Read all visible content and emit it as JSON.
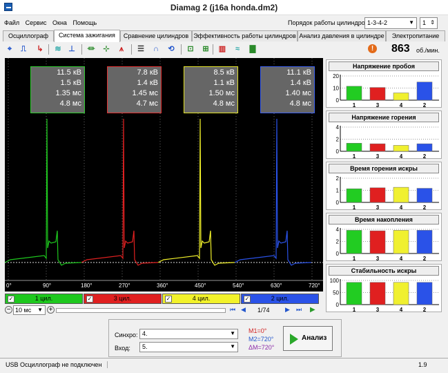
{
  "window": {
    "title": "Diamag 2 (j16a honda.dm2)"
  },
  "menu": [
    "Файл",
    "Сервис",
    "Окна",
    "Помощь"
  ],
  "cylinder_order": {
    "label": "Порядок работы цилиндров",
    "value": "1-3-4-2",
    "count": "1"
  },
  "tabs": [
    "Осциллограф",
    "Система зажигания",
    "Сравнение цилиндров",
    "Эффективность работы цилиндров",
    "Анализ давления в цилиндре",
    "Электропитание"
  ],
  "rpm": {
    "value": "863",
    "unit": "об./мин."
  },
  "readouts": [
    {
      "kv": "11.5 кВ",
      "kv2": "1.5 кВ",
      "ms": "1.35 мс",
      "ms2": "4.8 мс",
      "color": "#2ecc2e"
    },
    {
      "kv": "7.8 кВ",
      "kv2": "1.4 кВ",
      "ms": "1.45 мс",
      "ms2": "4.7 мс",
      "color": "#e23030"
    },
    {
      "kv": "8.5 кВ",
      "kv2": "1.1 кВ",
      "ms": "1.50 мс",
      "ms2": "4.8 мс",
      "color": "#e6e62a"
    },
    {
      "kv": "11.1 кВ",
      "kv2": "1.4 кВ",
      "ms": "1.40 мс",
      "ms2": "4.8 мс",
      "color": "#3a5ef0"
    }
  ],
  "degrees": [
    "0°",
    "90°",
    "180°",
    "270°",
    "360°",
    "450°",
    "540°",
    "630°",
    "720°"
  ],
  "cylinders": [
    {
      "label": "1 цил.",
      "color": "#1ec81e"
    },
    {
      "label": "3 цил.",
      "color": "#e02020"
    },
    {
      "label": "4 цил.",
      "color": "#f2f22a"
    },
    {
      "label": "2 цил.",
      "color": "#2a52e8"
    }
  ],
  "controls": {
    "timebase": "10 мс",
    "page": "1/74"
  },
  "panels": [
    {
      "title": "Напряжение пробоя",
      "yticks": [
        "20",
        "10",
        "0"
      ],
      "ymax": 20,
      "values": [
        11.5,
        10.5,
        6,
        15
      ]
    },
    {
      "title": "Напряжение горения",
      "yticks": [
        "4",
        "2",
        "0"
      ],
      "ymax": 4.5,
      "values": [
        1.5,
        1.4,
        1.1,
        1.4
      ]
    },
    {
      "title": "Время горения искры",
      "yticks": [
        "2",
        "1",
        "0"
      ],
      "ymax": 2.4,
      "values": [
        1.35,
        1.45,
        1.5,
        1.4
      ]
    },
    {
      "title": "Время накопления",
      "yticks": [
        "4",
        "2",
        "0"
      ],
      "ymax": 5,
      "values": [
        4.8,
        4.7,
        4.8,
        4.8
      ]
    },
    {
      "title": "Стабильность искры",
      "yticks": [
        "100",
        "50",
        "0"
      ],
      "ymax": 100,
      "values": [
        92,
        92,
        92,
        92
      ]
    }
  ],
  "panel_xlabels": [
    "1",
    "3",
    "4",
    "2"
  ],
  "bar_colors": [
    "#22cc22",
    "#e02020",
    "#f0f030",
    "#2a52e8"
  ],
  "analysis": {
    "sync_label": "Синхро:",
    "sync_value": "4.",
    "input_label": "Вход:",
    "input_value": "5.",
    "m1": "M1=0°",
    "m2": "M2=720°",
    "dm": "ΔM=720°",
    "button": "Анализ"
  },
  "status": {
    "text": "USB Осциллограф не подключен",
    "version": "1.9"
  }
}
